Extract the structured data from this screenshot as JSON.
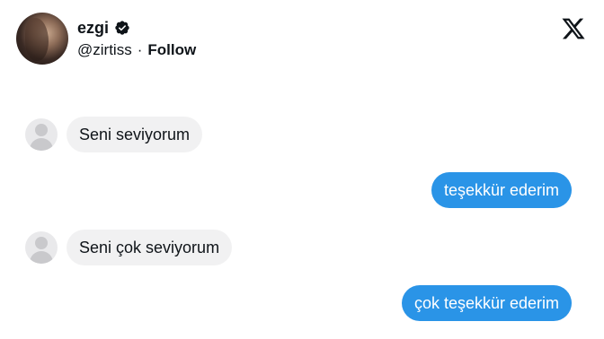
{
  "header": {
    "name": "ezgi",
    "handle": "@zirtiss",
    "separator": "·",
    "follow_label": "Follow"
  },
  "icons": {
    "verified": "verified-badge-icon",
    "x": "x-logo-icon",
    "avatar": "avatar-placeholder-icon"
  },
  "colors": {
    "outgoing_bubble": "#2a94e7",
    "incoming_bubble": "#f1f1f2",
    "text": "#0f1419"
  },
  "messages": [
    {
      "direction": "incoming",
      "text": "Seni seviyorum"
    },
    {
      "direction": "outgoing",
      "text": "teşekkür ederim"
    },
    {
      "direction": "incoming",
      "text": "Seni çok seviyorum"
    },
    {
      "direction": "outgoing",
      "text": "çok teşekkür ederim"
    }
  ]
}
